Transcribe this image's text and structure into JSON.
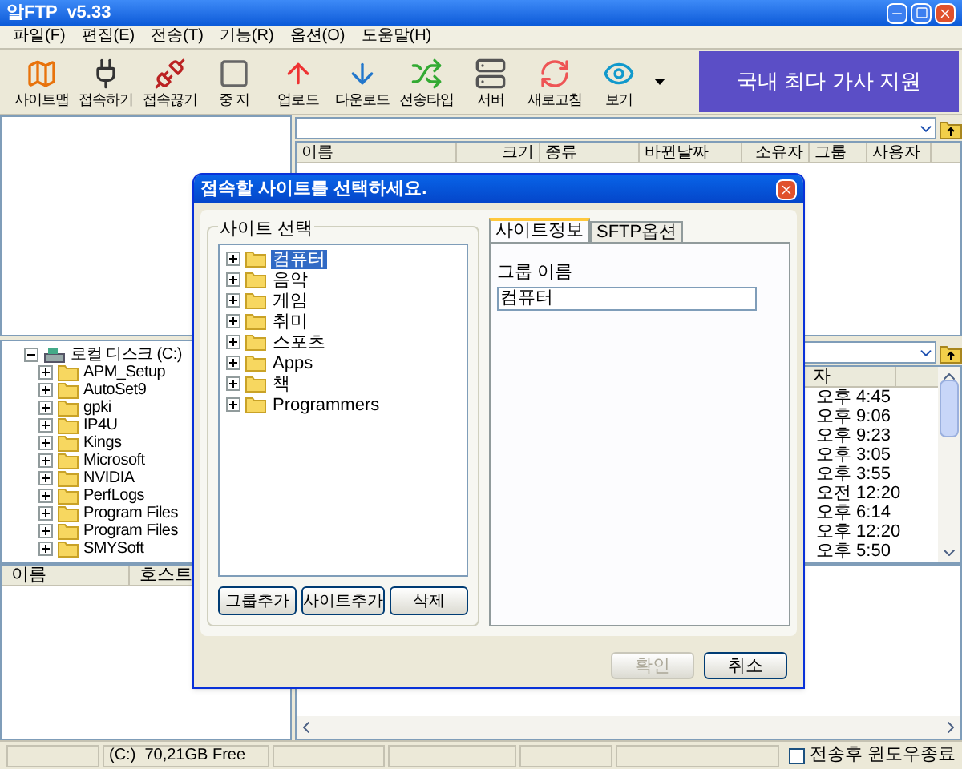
{
  "window": {
    "title": "알FTP  v5.33"
  },
  "menu": [
    "파일(F)",
    "편집(E)",
    "전송(T)",
    "기능(R)",
    "옵션(O)",
    "도움말(H)"
  ],
  "toolbar": {
    "buttons": [
      {
        "label": "사이트맵",
        "kind": "map"
      },
      {
        "label": "접속하기",
        "kind": "connect"
      },
      {
        "label": "접속끊기",
        "kind": "disconnect"
      },
      {
        "label": "중 지",
        "kind": "stop"
      },
      {
        "label": "업로드",
        "kind": "upload"
      },
      {
        "label": "다운로드",
        "kind": "download"
      },
      {
        "label": "전송타입",
        "kind": "type"
      },
      {
        "label": "서버",
        "kind": "server"
      },
      {
        "label": "새로고침",
        "kind": "refresh"
      },
      {
        "label": "보기",
        "kind": "view"
      }
    ],
    "banner": "국내 최다 가사 지원"
  },
  "remote": {
    "columns": [
      "이름",
      "크기",
      "종류",
      "바뀐날짜",
      "소유자",
      "그룹",
      "사용자"
    ]
  },
  "local": {
    "tree": {
      "label": "로컬 디스크 (C:)",
      "expanded": true,
      "children": [
        {
          "label": "APM_Setup",
          "expanded": false
        },
        {
          "label": "AutoSet9",
          "expanded": false
        },
        {
          "label": "gpki",
          "expanded": false
        },
        {
          "label": "IP4U",
          "expanded": false
        },
        {
          "label": "Kings",
          "expanded": false
        },
        {
          "label": "Microsoft",
          "expanded": false
        },
        {
          "label": "NVIDIA",
          "expanded": false
        },
        {
          "label": "PerfLogs",
          "expanded": false
        },
        {
          "label": "Program Files",
          "expanded": false
        },
        {
          "label": "Program Files",
          "expanded": false
        },
        {
          "label": "SMYSoft",
          "expanded": false
        }
      ]
    },
    "list_columns": [
      "이름",
      "호스트"
    ]
  },
  "remote_lower": {
    "column": "자",
    "times": [
      "오후 4:45",
      "오후 9:06",
      "오후 9:23",
      "오후 3:05",
      "오후 3:55",
      "오전 12:20",
      "오후 6:14",
      "오후 12:20",
      "오후 5:50"
    ]
  },
  "status_bar": {
    "drive_free": "(C:)  70,21GB Free",
    "close_after_transfer": {
      "label": "전송후 윈도우종료",
      "checked": false
    }
  },
  "dialog": {
    "title": "접속할 사이트를 선택하세요.",
    "group_label": "사이트 선택",
    "sites": [
      {
        "label": "컴퓨터",
        "selected": true,
        "expanded": false
      },
      {
        "label": "음악",
        "selected": false,
        "expanded": false
      },
      {
        "label": "게임",
        "selected": false,
        "expanded": false
      },
      {
        "label": "취미",
        "selected": false,
        "expanded": false
      },
      {
        "label": "스포츠",
        "selected": false,
        "expanded": false
      },
      {
        "label": "Apps",
        "selected": false,
        "expanded": false
      },
      {
        "label": "책",
        "selected": false,
        "expanded": false
      },
      {
        "label": "Programmers",
        "selected": false,
        "expanded": false
      }
    ],
    "site_buttons": [
      "그룹추가",
      "사이트추가",
      "삭제"
    ],
    "tabs": [
      {
        "label": "사이트정보",
        "selected": true
      },
      {
        "label": "SFTP옵션",
        "selected": false
      }
    ],
    "field_label": "그룹 이름",
    "field_value": "컴퓨터",
    "buttons": [
      {
        "label": "확인",
        "disabled": true
      },
      {
        "label": "취소",
        "disabled": false
      }
    ]
  }
}
